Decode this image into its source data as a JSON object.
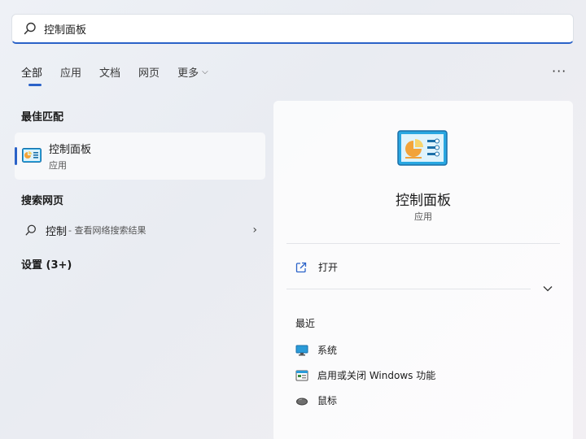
{
  "search": {
    "value": "控制面板"
  },
  "tabs": [
    {
      "label": "全部"
    },
    {
      "label": "应用"
    },
    {
      "label": "文档"
    },
    {
      "label": "网页"
    },
    {
      "label": "更多"
    }
  ],
  "sections": {
    "best_match": "最佳匹配",
    "search_web": "搜索网页",
    "settings": "设置 (3+)"
  },
  "best_match_item": {
    "name": "控制面板",
    "type": "应用"
  },
  "web_result": {
    "query": "控制",
    "hint": "- 查看网络搜索结果"
  },
  "detail": {
    "title": "控制面板",
    "type": "应用",
    "open_label": "打开",
    "recent_title": "最近",
    "recent": [
      {
        "label": "系统",
        "icon": "monitor-icon"
      },
      {
        "label": "启用或关闭 Windows 功能",
        "icon": "windows-features-icon"
      },
      {
        "label": "鼠标",
        "icon": "mouse-icon"
      }
    ]
  },
  "colors": {
    "accent": "#2a62c8"
  }
}
